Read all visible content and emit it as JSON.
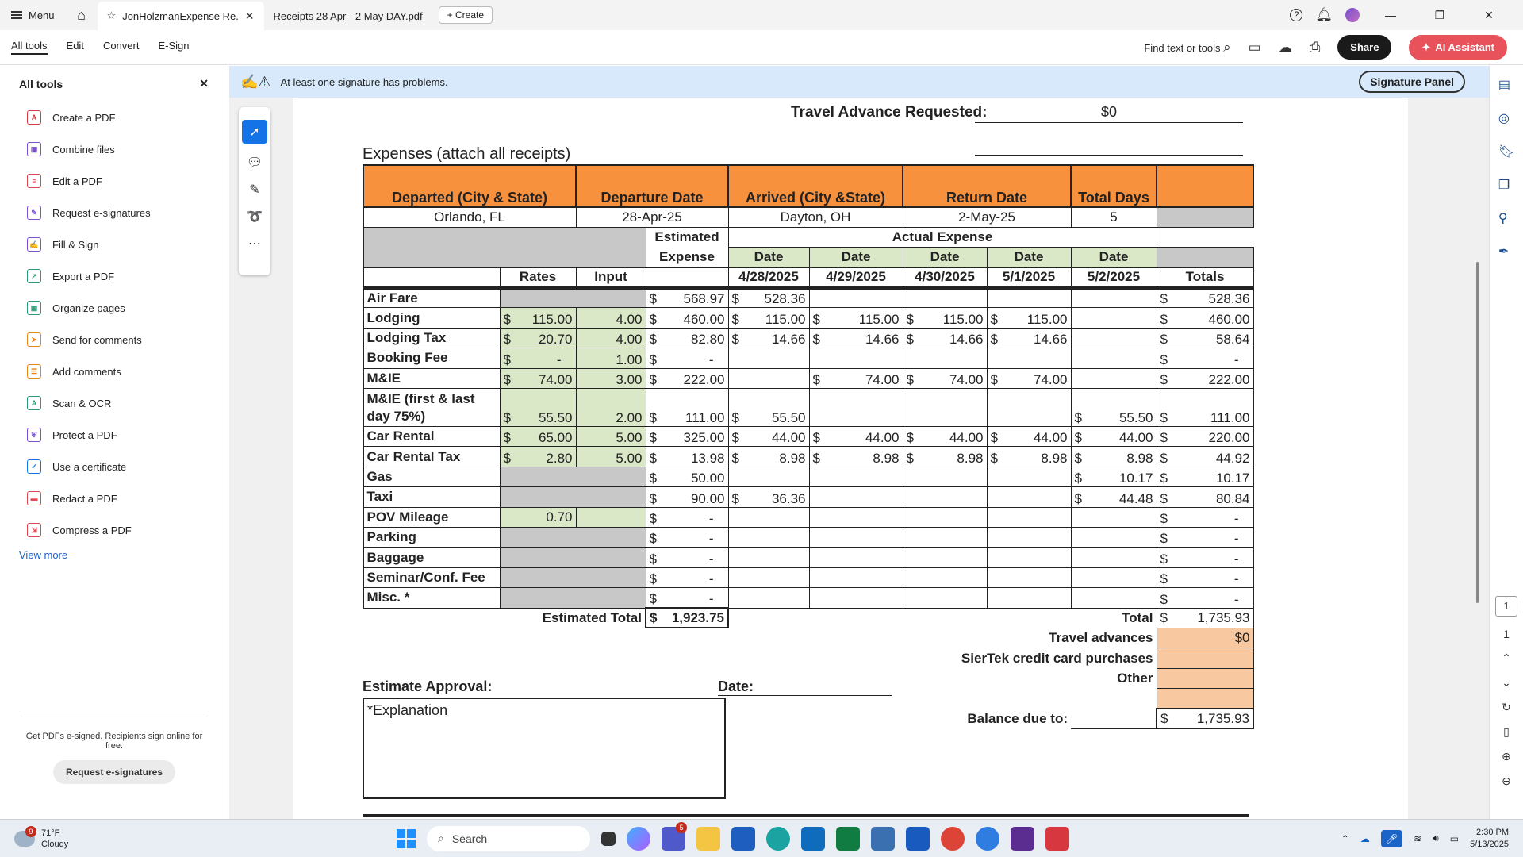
{
  "titlebar": {
    "menu_label": "Menu",
    "tabs": [
      {
        "label": "JonHolzmanExpense Re..."
      },
      {
        "label": "Receipts 28 Apr - 2 May DAY.pdf"
      }
    ],
    "create_label": "Create"
  },
  "toolbar": {
    "menus": [
      "All tools",
      "Edit",
      "Convert",
      "E-Sign"
    ],
    "find_label": "Find text or tools",
    "share_label": "Share",
    "ai_label": "AI Assistant"
  },
  "left_panel": {
    "title": "All tools",
    "items": [
      {
        "label": "Create a PDF",
        "icon": "create-pdf-icon",
        "color": "#d7373f",
        "glyph": "A"
      },
      {
        "label": "Combine files",
        "icon": "combine-files-icon",
        "color": "#7a4fd0",
        "glyph": "▣"
      },
      {
        "label": "Edit a PDF",
        "icon": "edit-pdf-icon",
        "color": "#e34850",
        "glyph": "≡"
      },
      {
        "label": "Request e-signatures",
        "icon": "request-esign-icon",
        "color": "#7a4fd0",
        "glyph": "✎"
      },
      {
        "label": "Fill & Sign",
        "icon": "fill-sign-icon",
        "color": "#7a4fd0",
        "glyph": "✍"
      },
      {
        "label": "Export a PDF",
        "icon": "export-pdf-icon",
        "color": "#2d9d78",
        "glyph": "↗"
      },
      {
        "label": "Organize pages",
        "icon": "organize-pages-icon",
        "color": "#2d9d78",
        "glyph": "▦"
      },
      {
        "label": "Send for comments",
        "icon": "send-comments-icon",
        "color": "#e68619",
        "glyph": "➤"
      },
      {
        "label": "Add comments",
        "icon": "add-comments-icon",
        "color": "#e68619",
        "glyph": "☰"
      },
      {
        "label": "Scan & OCR",
        "icon": "scan-ocr-icon",
        "color": "#2d9d78",
        "glyph": "A"
      },
      {
        "label": "Protect a PDF",
        "icon": "protect-pdf-icon",
        "color": "#7a4fd0",
        "glyph": "⛨"
      },
      {
        "label": "Use a certificate",
        "icon": "certificate-icon",
        "color": "#1473e6",
        "glyph": "✓"
      },
      {
        "label": "Redact a PDF",
        "icon": "redact-pdf-icon",
        "color": "#e34850",
        "glyph": "▬"
      },
      {
        "label": "Compress a PDF",
        "icon": "compress-pdf-icon",
        "color": "#e34850",
        "glyph": "⇲"
      }
    ],
    "view_more": "View more",
    "footer_text": "Get PDFs e-signed. Recipients sign online for free.",
    "footer_button": "Request e-signatures"
  },
  "signature_bar": {
    "message": "At least one signature has problems.",
    "button": "Signature Panel"
  },
  "form": {
    "travel_advance_label": "Travel Advance Requested:",
    "travel_advance_value": "$0",
    "expenses_title": "Expenses  (attach all receipts)",
    "headers": [
      "Departed (City & State)",
      "Departure Date",
      "Arrived (City &State)",
      "Return Date",
      "Total Days"
    ],
    "trip": [
      "Orlando, FL",
      "28-Apr-25",
      "Dayton, OH",
      "2-May-25",
      "5"
    ],
    "estimated_expense": "Estimated Expense",
    "estimated_1": "Estimated",
    "estimated_2": "Expense",
    "actual_expense": "Actual Expense",
    "date_label": "Date",
    "rates_label": "Rates",
    "input_label": "Input",
    "dates": [
      "4/28/2025",
      "4/29/2025",
      "4/30/2025",
      "5/1/2025",
      "5/2/2025"
    ],
    "totals_label": "Totals",
    "rows": [
      {
        "name": "Air Fare",
        "rate": "",
        "input": "",
        "est": "568.97",
        "d": [
          "528.36",
          "",
          "",
          "",
          ""
        ],
        "total": "528.36"
      },
      {
        "name": "Lodging",
        "rate": "115.00",
        "input": "4.00",
        "est": "460.00",
        "d": [
          "115.00",
          "115.00",
          "115.00",
          "115.00",
          ""
        ],
        "total": "460.00"
      },
      {
        "name": "Lodging Tax",
        "rate": "20.70",
        "input": "4.00",
        "est": "82.80",
        "d": [
          "14.66",
          "14.66",
          "14.66",
          "14.66",
          ""
        ],
        "total": "58.64"
      },
      {
        "name": "Booking Fee",
        "rate": "-",
        "input": "1.00",
        "est": "-",
        "d": [
          "",
          "",
          "",
          "",
          ""
        ],
        "total": "-"
      },
      {
        "name": "M&IE",
        "rate": "74.00",
        "input": "3.00",
        "est": "222.00",
        "d": [
          "",
          "74.00",
          "74.00",
          "74.00",
          ""
        ],
        "total": "222.00"
      },
      {
        "name": "M&IE (first & last day 75%)",
        "rate": "55.50",
        "input": "2.00",
        "est": "111.00",
        "d": [
          "55.50",
          "",
          "",
          "",
          "55.50"
        ],
        "total": "111.00"
      },
      {
        "name": "Car Rental",
        "rate": "65.00",
        "input": "5.00",
        "est": "325.00",
        "d": [
          "44.00",
          "44.00",
          "44.00",
          "44.00",
          "44.00"
        ],
        "total": "220.00"
      },
      {
        "name": "Car Rental Tax",
        "rate": "2.80",
        "input": "5.00",
        "est": "13.98",
        "d": [
          "8.98",
          "8.98",
          "8.98",
          "8.98",
          "8.98"
        ],
        "total": "44.92"
      },
      {
        "name": "Gas",
        "rate": "",
        "input": "",
        "est": "50.00",
        "d": [
          "",
          "",
          "",
          "",
          "10.17"
        ],
        "total": "10.17"
      },
      {
        "name": "Taxi",
        "rate": "",
        "input": "",
        "est": "90.00",
        "d": [
          "36.36",
          "",
          "",
          "",
          "44.48"
        ],
        "total": "80.84"
      },
      {
        "name": "POV Mileage",
        "rate": "0.70",
        "input": "",
        "est": "-",
        "d": [
          "",
          "",
          "",
          "",
          ""
        ],
        "total": "-"
      },
      {
        "name": "Parking",
        "rate": "",
        "input": "",
        "est": "-",
        "d": [
          "",
          "",
          "",
          "",
          ""
        ],
        "total": "-"
      },
      {
        "name": "Baggage",
        "rate": "",
        "input": "",
        "est": "-",
        "d": [
          "",
          "",
          "",
          "",
          ""
        ],
        "total": "-"
      },
      {
        "name": "Seminar/Conf. Fee",
        "rate": "",
        "input": "",
        "est": "-",
        "d": [
          "",
          "",
          "",
          "",
          ""
        ],
        "total": "-"
      },
      {
        "name": "Misc. *",
        "rate": "",
        "input": "",
        "est": "-",
        "d": [
          "",
          "",
          "",
          "",
          ""
        ],
        "total": "-"
      }
    ],
    "estimated_total_label": "Estimated Total",
    "estimated_total_value": "1,923.75",
    "total_label": "Total",
    "total_value": "1,735.93",
    "travel_advances_label": "Travel advances",
    "travel_advances_value": "$0",
    "siertek_label": "SierTek credit card purchases",
    "other_label": "Other",
    "balance_label": "Balance due to:",
    "balance_value": "1,735.93",
    "estimate_approval": "Estimate Approval:",
    "date_field_label": "Date:",
    "explanation": "*Explanation",
    "dollar": "$"
  },
  "right_rail": {
    "page_current": "1",
    "page_total": "1"
  },
  "taskbar": {
    "temperature": "71°F",
    "condition": "Cloudy",
    "weather_badge": "9",
    "search_placeholder": "Search",
    "teams_badge": "5",
    "time": "2:30 PM",
    "date": "5/13/2025"
  }
}
